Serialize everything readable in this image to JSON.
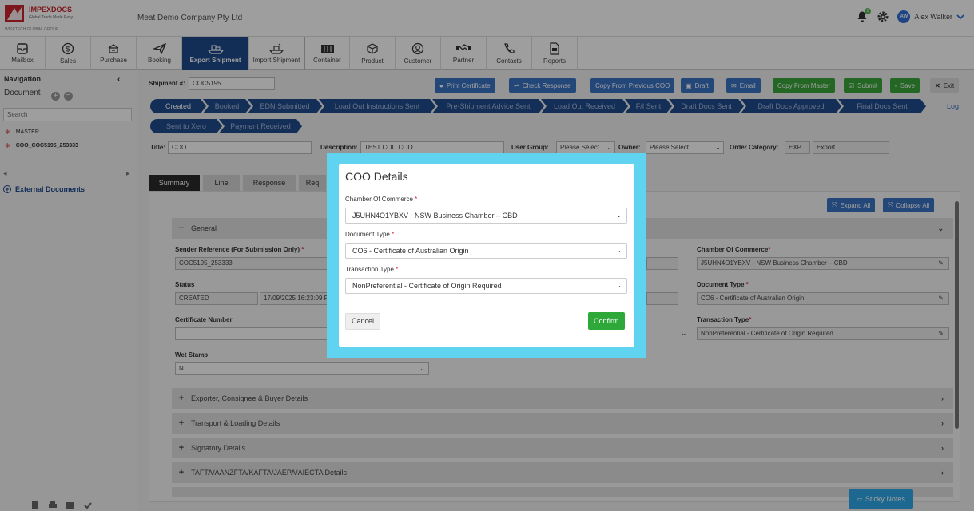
{
  "brand": {
    "name": "IMPEXDOCS",
    "tagline": "Global Trade Made Easy",
    "group": "WISETECH GLOBAL GROUP"
  },
  "company": "Meat Demo Company Pty Ltd",
  "notifications": {
    "count": "5"
  },
  "user": {
    "initials": "AW",
    "name": "Alex Walker"
  },
  "nav": [
    "Mailbox",
    "Sales",
    "Purchase",
    "Booking",
    "Export Shipment",
    "Import Shipment",
    "Container",
    "Product",
    "Customer",
    "Partner",
    "Contacts",
    "Reports"
  ],
  "sidebar": {
    "title": "Navigation",
    "document_label": "Document",
    "search_placeholder": "Search",
    "tree": [
      "MASTER",
      "COO_COC5195_253333"
    ],
    "external": "External Documents"
  },
  "toolbar": {
    "shipment_label": "Shipment #:",
    "shipment_no": "COC5195",
    "print": "Print Certificate",
    "check": "Check Response",
    "copy_prev": "Copy From Previous COO",
    "draft": "Draft",
    "email": "Email",
    "copy_master": "Copy From Master",
    "submit": "Submit",
    "save": "Save",
    "exit": "Exit"
  },
  "statuses": [
    "Created",
    "Booked",
    "EDN Submitted",
    "Load Out Instructions Sent",
    "Pre-Shipment Advice Sent",
    "Load Out Received",
    "F/I Sent",
    "Draft Docs Sent",
    "Draft Docs Approved",
    "Final Docs Sent",
    "Sent to Xero",
    "Payment Received"
  ],
  "log_link": "Log",
  "header_fields": {
    "title_label": "Title:",
    "title": "COO",
    "desc_label": "Description:",
    "desc": "TEST COC COO",
    "usergroup_label": "User Group:",
    "usergroup": "Please Select",
    "owner_label": "Owner:",
    "owner": "Please Select",
    "order_label": "Order Category:",
    "order_code": "EXP",
    "order_name": "Export"
  },
  "tabs": [
    "Summary",
    "Line",
    "Response",
    "Req"
  ],
  "panel": {
    "expand": "Expand All",
    "collapse": "Collapse All",
    "general": "General",
    "sender_ref_label": "Sender Reference (For Submission Only)",
    "sender_ref": "COC5195_253333",
    "status_label": "Status",
    "status": "CREATED",
    "status_date": "17/09/2025 16:23:09 PM",
    "cert_label": "Certificate Number",
    "wet_label": "Wet Stamp",
    "wet": "N",
    "coc_label": "Chamber Of Commerce",
    "coc": "J5UHN4O1YBXV - NSW Business Chamber – CBD",
    "doctype_label": "Document Type",
    "doctype": "CO6 - Certificate of Australian Origin",
    "trans_label": "Transaction Type",
    "trans": "NonPreferential - Certificate of Origin Required"
  },
  "sections": [
    "Exporter, Consignee & Buyer Details",
    "Transport & Loading Details",
    "Signatory Details",
    "TAFTA/AANZFTA/KAFTA/JAEPA/AIECTA Details"
  ],
  "sticky": "Sticky Notes",
  "modal": {
    "title": "COO Details",
    "coc_label": "Chamber Of Commerce",
    "coc": "J5UHN4O1YBXV - NSW Business Chamber – CBD",
    "doctype_label": "Document Type",
    "doctype": "CO6 - Certificate of Australian Origin",
    "trans_label": "Transaction Type",
    "trans": "NonPreferential - Certificate of Origin Required",
    "cancel": "Cancel",
    "confirm": "Confirm"
  }
}
